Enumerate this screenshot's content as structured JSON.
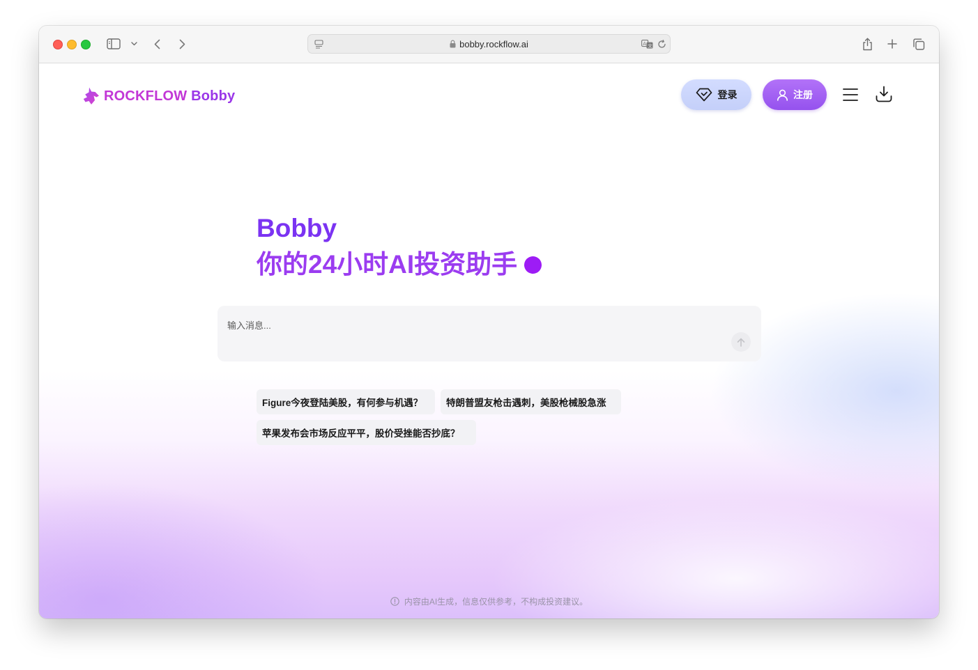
{
  "browser": {
    "url": "bobby.rockflow.ai"
  },
  "header": {
    "logo_brand": "ROCKFLOW",
    "logo_product": "Bobby",
    "login_label": "登录",
    "register_label": "注册"
  },
  "hero": {
    "title": "Bobby",
    "subtitle": "你的24小时AI投资助手"
  },
  "chat": {
    "placeholder": "输入消息..."
  },
  "suggestions": [
    "Figure今夜登陆美股，有何参与机遇？",
    "特朗普盟友枪击遇刺，美股枪械股急涨",
    "苹果发布会市场反应平平，股价受挫能否抄底？"
  ],
  "footer": {
    "disclaimer": "内容由AI生成，信息仅供参考，不构成投资建议。"
  },
  "colors": {
    "brand_pink": "#c237d6",
    "brand_purple": "#9a36e8",
    "hero_purple": "#8a3cf0",
    "register_button": "#9552ee",
    "login_button": "#c4cff9"
  }
}
